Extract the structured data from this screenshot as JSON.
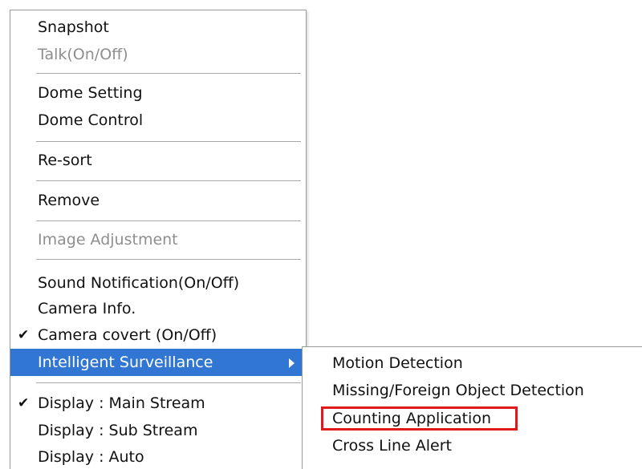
{
  "context_menu": {
    "items": [
      {
        "label": "Snapshot"
      },
      {
        "label": "Talk(On/Off)"
      },
      {
        "label": "Dome Setting"
      },
      {
        "label": "Dome Control"
      },
      {
        "label": "Re-sort"
      },
      {
        "label": "Remove"
      },
      {
        "label": "Image Adjustment"
      },
      {
        "label": "Sound Notification(On/Off)"
      },
      {
        "label": "Camera Info."
      },
      {
        "label": "Camera covert (On/Off)",
        "check": "✔"
      },
      {
        "label": "Intelligent Surveillance"
      },
      {
        "label": "Display : Main Stream",
        "check": "✔"
      },
      {
        "label": "Display : Sub Stream"
      },
      {
        "label": "Display : Auto"
      }
    ]
  },
  "submenu": {
    "parent": "Intelligent Surveillance",
    "items": [
      {
        "label": "Motion Detection"
      },
      {
        "label": "Missing/Foreign Object Detection"
      },
      {
        "label": "Counting Application"
      },
      {
        "label": "Cross Line Alert"
      }
    ]
  },
  "colors": {
    "highlight": "#3276d4",
    "annotation_box": "#e01a1a",
    "disabled_text": "#8e8e8e"
  },
  "icons": {
    "check": "check-icon",
    "submenu_arrow": "chevron-right-icon"
  }
}
